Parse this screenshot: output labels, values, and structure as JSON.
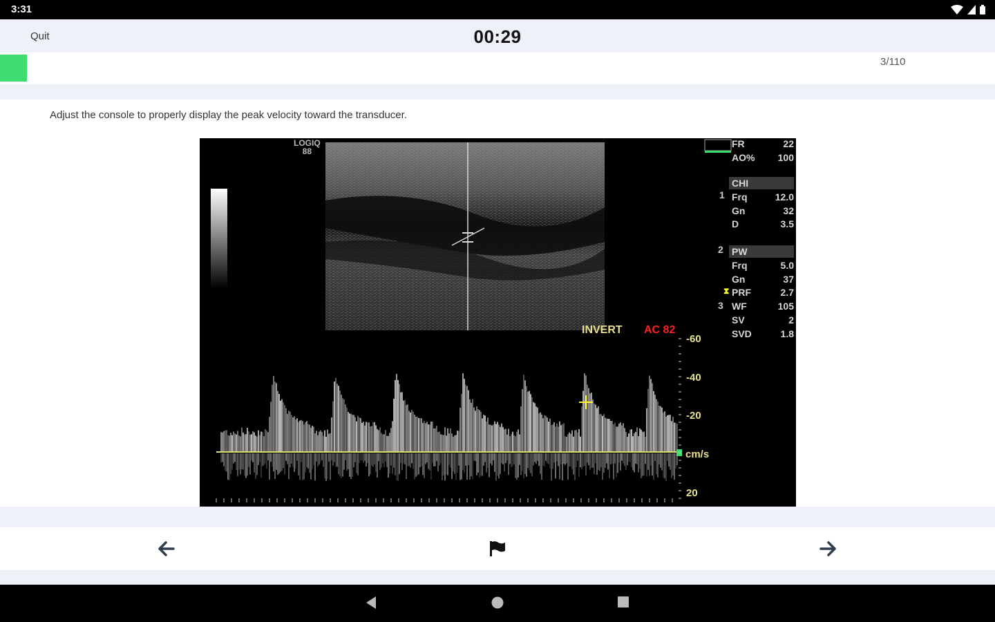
{
  "status_bar": {
    "time": "3:31",
    "icons": [
      "wifi-icon",
      "signal-icon",
      "battery-icon"
    ]
  },
  "header": {
    "quit_label": "Quit",
    "timer": "00:29"
  },
  "progress": {
    "counter": "3/110",
    "current": 3,
    "total": 110,
    "fill_color": "#3ddc6f"
  },
  "question": {
    "text": "Adjust the console to properly display the peak velocity toward the transducer."
  },
  "ultrasound": {
    "brand": "LOGIQ",
    "brand_sub": "88",
    "params_top": [
      {
        "label": "FR",
        "value": "22"
      },
      {
        "label": "AO%",
        "value": "100"
      }
    ],
    "section_chi": "CHI",
    "params_chi": [
      {
        "label": "Frq",
        "value": "12.0"
      },
      {
        "label": "Gn",
        "value": "32"
      },
      {
        "label": "D",
        "value": "3.5"
      }
    ],
    "section_pw": "PW",
    "params_pw": [
      {
        "label": "Frq",
        "value": "5.0"
      },
      {
        "label": "Gn",
        "value": "37"
      },
      {
        "label": "PRF",
        "value": "2.7"
      },
      {
        "label": "WF",
        "value": "105"
      },
      {
        "label": "SV",
        "value": "2"
      },
      {
        "label": "SVD",
        "value": "1.8"
      }
    ],
    "depth_marks": [
      "1",
      "2",
      "3"
    ],
    "invert_label": "INVERT",
    "ac_label": "AC 82",
    "scale": [
      "-60",
      "-40",
      "-20",
      "cm/s",
      "20"
    ],
    "colors": {
      "invert": "#e8e08a",
      "ac": "#ff2020",
      "cursor": "#ffff33",
      "baseline": "#d8e070",
      "marker": "#3ddc6f"
    }
  },
  "navigation": {
    "prev_icon": "arrow-left-icon",
    "flag_icon": "flag-icon",
    "next_icon": "arrow-right-icon"
  },
  "system_nav": [
    "back-icon",
    "home-icon",
    "recents-icon"
  ]
}
